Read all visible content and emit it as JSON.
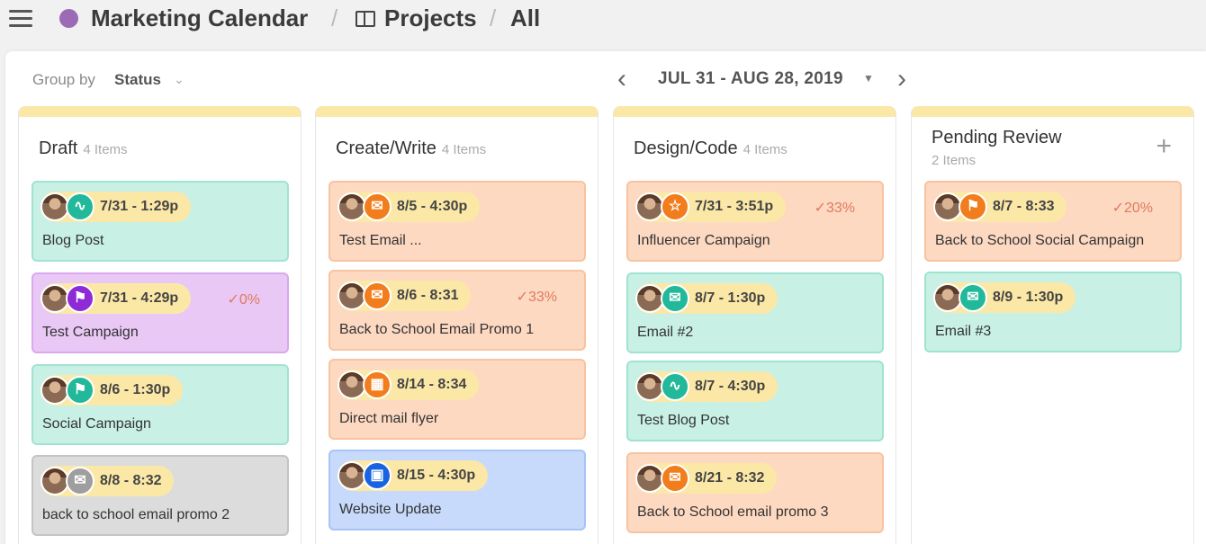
{
  "header": {
    "title": "Marketing Calendar",
    "separator": "/",
    "crumb2": "Projects",
    "crumb3": "All",
    "dot_color": "#9b6bb5"
  },
  "toolbar": {
    "group_by_label": "Group by",
    "group_by_value": "Status",
    "date_range": "JUL 31 - AUG 28, 2019"
  },
  "icons": {
    "rss": "rss-icon",
    "megaphone": "megaphone-icon",
    "email": "email-icon",
    "star": "star-icon",
    "map": "map-icon",
    "monitor": "monitor-icon"
  },
  "columns": [
    {
      "title": "Draft",
      "count": "4 Items",
      "cards": [
        {
          "date": "7/31 - 1:29p",
          "title": "Blog Post",
          "icon": "rss",
          "icon_color": "#22b89a",
          "bg": "#c8f0e5",
          "border": "#9fe3d0",
          "progress": ""
        },
        {
          "date": "7/31 - 4:29p",
          "title": "Test Campaign",
          "icon": "megaphone",
          "icon_color": "#8e2bd6",
          "bg": "#e9c8f5",
          "border": "#d9a8ef",
          "progress": "✓0%"
        },
        {
          "date": "8/6 - 1:30p",
          "title": "Social Campaign",
          "icon": "megaphone",
          "icon_color": "#22b89a",
          "bg": "#c8f0e5",
          "border": "#9fe3d0",
          "progress": ""
        },
        {
          "date": "8/8 - 8:32",
          "title": "back to school email promo 2",
          "icon": "email",
          "icon_color": "#9e9e9e",
          "bg": "#dcdcdc",
          "border": "#c4c4c4",
          "progress": ""
        }
      ]
    },
    {
      "title": "Create/Write",
      "count": "4 Items",
      "cards": [
        {
          "date": "8/5 - 4:30p",
          "title": "Test Email ...",
          "icon": "email",
          "icon_color": "#f27d1d",
          "bg": "#fdd9c2",
          "border": "#f7c3a0",
          "progress": ""
        },
        {
          "date": "8/6 - 8:31",
          "title": "Back to School Email Promo 1",
          "icon": "email",
          "icon_color": "#f27d1d",
          "bg": "#fdd9c2",
          "border": "#f7c3a0",
          "progress": "✓33%"
        },
        {
          "date": "8/14 - 8:34",
          "title": "Direct mail flyer",
          "icon": "map",
          "icon_color": "#f27d1d",
          "bg": "#fdd9c2",
          "border": "#f7c3a0",
          "progress": ""
        },
        {
          "date": "8/15 - 4:30p",
          "title": "Website Update",
          "icon": "monitor",
          "icon_color": "#1a63e0",
          "bg": "#c7dafb",
          "border": "#a6c4f5",
          "progress": ""
        }
      ]
    },
    {
      "title": "Design/Code",
      "count": "4 Items",
      "cards": [
        {
          "date": "7/31 - 3:51p",
          "title": "Influencer Campaign",
          "icon": "star",
          "icon_color": "#f27d1d",
          "bg": "#fdd9c2",
          "border": "#f7c3a0",
          "progress": "✓33%"
        },
        {
          "date": "8/7 - 1:30p",
          "title": "Email #2",
          "icon": "email",
          "icon_color": "#22b89a",
          "bg": "#c8f0e5",
          "border": "#9fe3d0",
          "progress": ""
        },
        {
          "date": "8/7 - 4:30p",
          "title": "Test Blog Post",
          "icon": "rss",
          "icon_color": "#22b89a",
          "bg": "#c8f0e5",
          "border": "#9fe3d0",
          "progress": ""
        },
        {
          "date": "8/21 - 8:32",
          "title": "Back to School email promo 3",
          "icon": "email",
          "icon_color": "#f27d1d",
          "bg": "#fdd9c2",
          "border": "#f7c3a0",
          "progress": ""
        }
      ]
    },
    {
      "title": "Pending Review",
      "count": "2 Items",
      "cards": [
        {
          "date": "8/7 - 8:33",
          "title": "Back to School Social Campaign",
          "icon": "megaphone",
          "icon_color": "#f27d1d",
          "bg": "#fdd9c2",
          "border": "#f7c3a0",
          "progress": "✓20%"
        },
        {
          "date": "8/9 - 1:30p",
          "title": "Email #3",
          "icon": "email",
          "icon_color": "#22b89a",
          "bg": "#c8f0e5",
          "border": "#9fe3d0",
          "progress": ""
        }
      ]
    }
  ]
}
